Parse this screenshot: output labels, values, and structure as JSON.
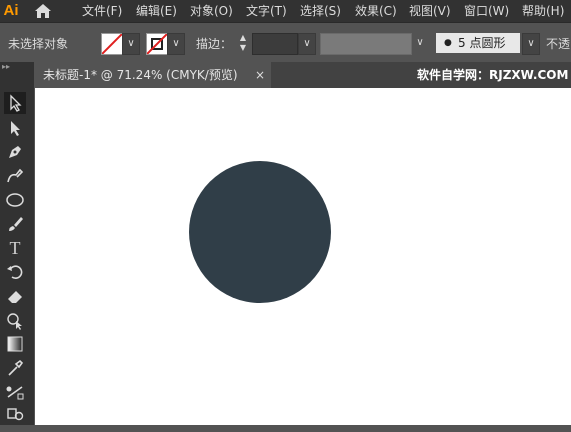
{
  "app": {
    "logo_text": "Ai"
  },
  "menu": {
    "items": [
      "文件(F)",
      "编辑(E)",
      "对象(O)",
      "文字(T)",
      "选择(S)",
      "效果(C)",
      "视图(V)",
      "窗口(W)",
      "帮助(H)"
    ]
  },
  "control_bar": {
    "selection_label": "未选择对象",
    "stroke_label": "描边：",
    "brush_label": "5 点圆形",
    "trailing_label": "不透"
  },
  "document": {
    "tab_title": "未标题-1* @ 71.24% (CMYK/预览)",
    "close_symbol": "×",
    "watermark": "软件自学网：RJZXW.COM"
  },
  "canvas": {
    "shape": "circle",
    "fill_color": "#303e48",
    "background_color": "#ffffff"
  },
  "colors": {
    "menubar_bg": "#323232",
    "panel_bg": "#535353",
    "brand_orange": "#ff9a00"
  },
  "tools": [
    "selection-tool",
    "direct-selection-tool",
    "pen-tool",
    "curvature-tool",
    "ellipse-tool",
    "paintbrush-tool",
    "type-tool",
    "rotate-tool",
    "eraser-tool",
    "shape-builder-tool",
    "gradient-tool",
    "eyedropper-tool",
    "blend-tool",
    "symbol-sprayer-tool"
  ]
}
